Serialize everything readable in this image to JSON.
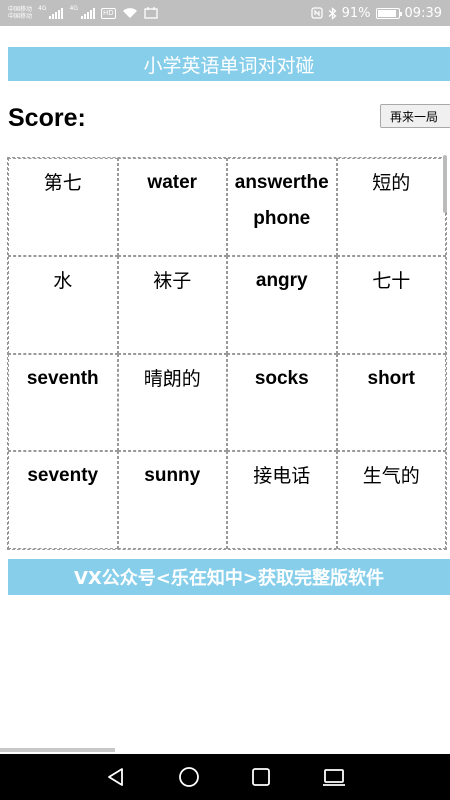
{
  "status_bar": {
    "carrier_1": "中国移动",
    "carrier_2": "中国移动",
    "network_1": "4G",
    "network_2": "4G",
    "hd_badge": "HD",
    "battery_percent": "91%",
    "battery_level": 0.91,
    "time": "09:39"
  },
  "header": {
    "title": "小学英语单词对对碰"
  },
  "score": {
    "label": "Score:",
    "value": ""
  },
  "restart_button": {
    "label": "再来一局"
  },
  "grid": {
    "cells": [
      "第七",
      "water",
      "answerthephone",
      "短的",
      "水",
      "袜子",
      "angry",
      "七十",
      "seventh",
      "晴朗的",
      "socks",
      "short",
      "seventy",
      "sunny",
      "接电话",
      "生气的"
    ]
  },
  "footer": {
    "text": "VX公众号<乐在知中>获取完整版软件"
  },
  "colors": {
    "banner": "#87ceeb",
    "status_bar": "#bfbfbf",
    "nav_bar": "#000000"
  },
  "nav": {
    "back_icon": "back-triangle-icon",
    "home_icon": "home-circle-icon",
    "recent_icon": "recent-square-icon",
    "keyboard_icon": "keyboard-icon"
  }
}
